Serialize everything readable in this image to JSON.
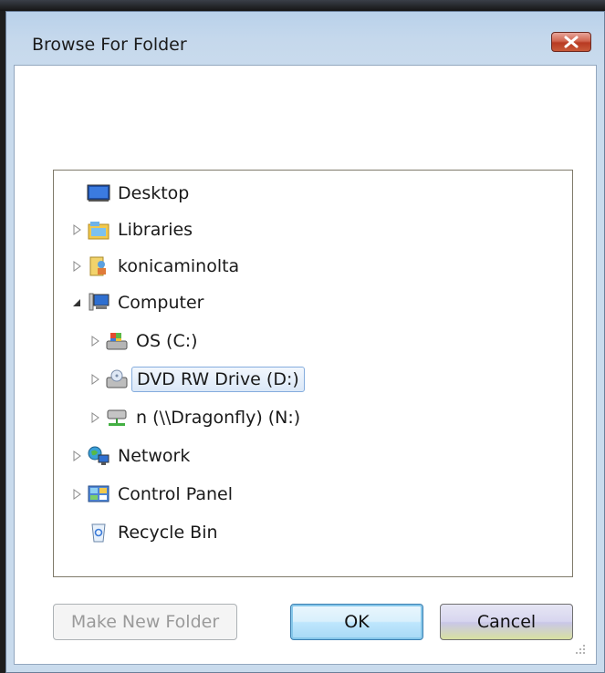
{
  "window": {
    "title": "Browse For Folder",
    "close_label": "Close"
  },
  "tree": {
    "items": [
      {
        "label": "Desktop",
        "icon": "desktop-icon",
        "expander": "none",
        "level": 0
      },
      {
        "label": "Libraries",
        "icon": "libraries-icon",
        "expander": "collapsed",
        "level": 0
      },
      {
        "label": "konicaminolta",
        "icon": "user-folder-icon",
        "expander": "collapsed",
        "level": 0
      },
      {
        "label": "Computer",
        "icon": "computer-icon",
        "expander": "expanded",
        "level": 0
      },
      {
        "label": "OS (C:)",
        "icon": "hard-drive-icon",
        "expander": "collapsed",
        "level": 1
      },
      {
        "label": "DVD RW Drive (D:)",
        "icon": "dvd-drive-icon",
        "expander": "collapsed",
        "level": 1,
        "selected": true
      },
      {
        "label": "n (\\\\Dragonfly) (N:)",
        "icon": "network-drive-icon",
        "expander": "collapsed",
        "level": 1
      },
      {
        "label": "Network",
        "icon": "network-icon",
        "expander": "collapsed",
        "level": 0
      },
      {
        "label": "Control Panel",
        "icon": "control-panel-icon",
        "expander": "collapsed",
        "level": 0
      },
      {
        "label": "Recycle Bin",
        "icon": "recycle-bin-icon",
        "expander": "none",
        "level": 0
      }
    ]
  },
  "buttons": {
    "make_new_folder": "Make New Folder",
    "ok": "OK",
    "cancel": "Cancel"
  },
  "colors": {
    "titlebar": "#c5d8ec",
    "close_button": "#c85a3a",
    "selection_border": "#84acdd"
  }
}
